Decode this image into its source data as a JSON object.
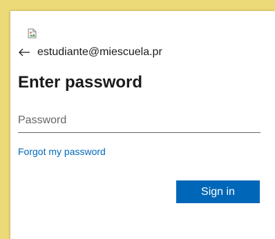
{
  "account": {
    "back_icon": "arrow-left-icon",
    "email": "estudiante@miescuela.pr"
  },
  "form": {
    "title": "Enter password",
    "password_placeholder": "Password",
    "password_value": "",
    "forgot_link": "Forgot my password",
    "sign_in_label": "Sign in"
  },
  "logo": {
    "icon": "broken-image-icon"
  },
  "colors": {
    "background": "#ecd977",
    "accent": "#0067b8",
    "text": "#1b1b1b"
  }
}
